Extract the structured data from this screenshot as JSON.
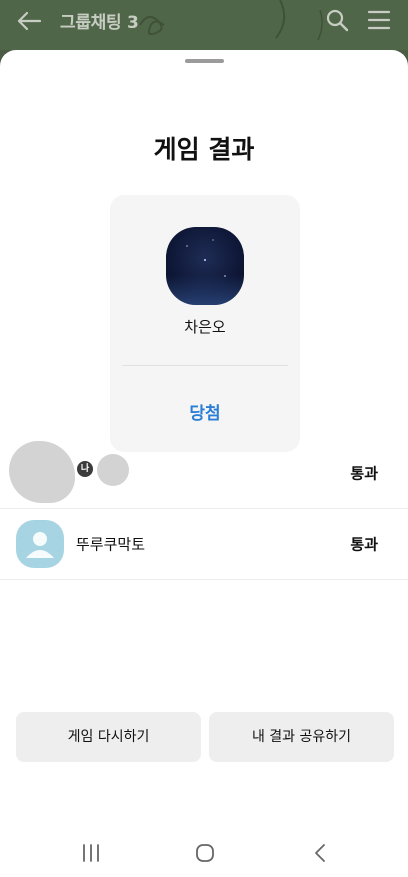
{
  "appbar": {
    "title": "그룹채팅 3",
    "back_icon": "arrow-left-icon",
    "search_icon": "search-icon",
    "menu_icon": "menu-icon",
    "background": "#506649"
  },
  "sheet": {
    "title": "게임 결과"
  },
  "result_card": {
    "name": "차은오",
    "result": "당첨",
    "result_color": "#2b7ed6"
  },
  "participants": [
    {
      "name": "",
      "me_badge": "나",
      "status": "통과"
    },
    {
      "name": "뚜루쿠막토",
      "status": "통과"
    }
  ],
  "actions": {
    "replay_label": "게임 다시하기",
    "share_label": "내 결과 공유하기"
  },
  "system_nav": {
    "recents_icon": "recents-icon",
    "home_icon": "home-icon",
    "back_icon": "back-chevron-icon"
  }
}
